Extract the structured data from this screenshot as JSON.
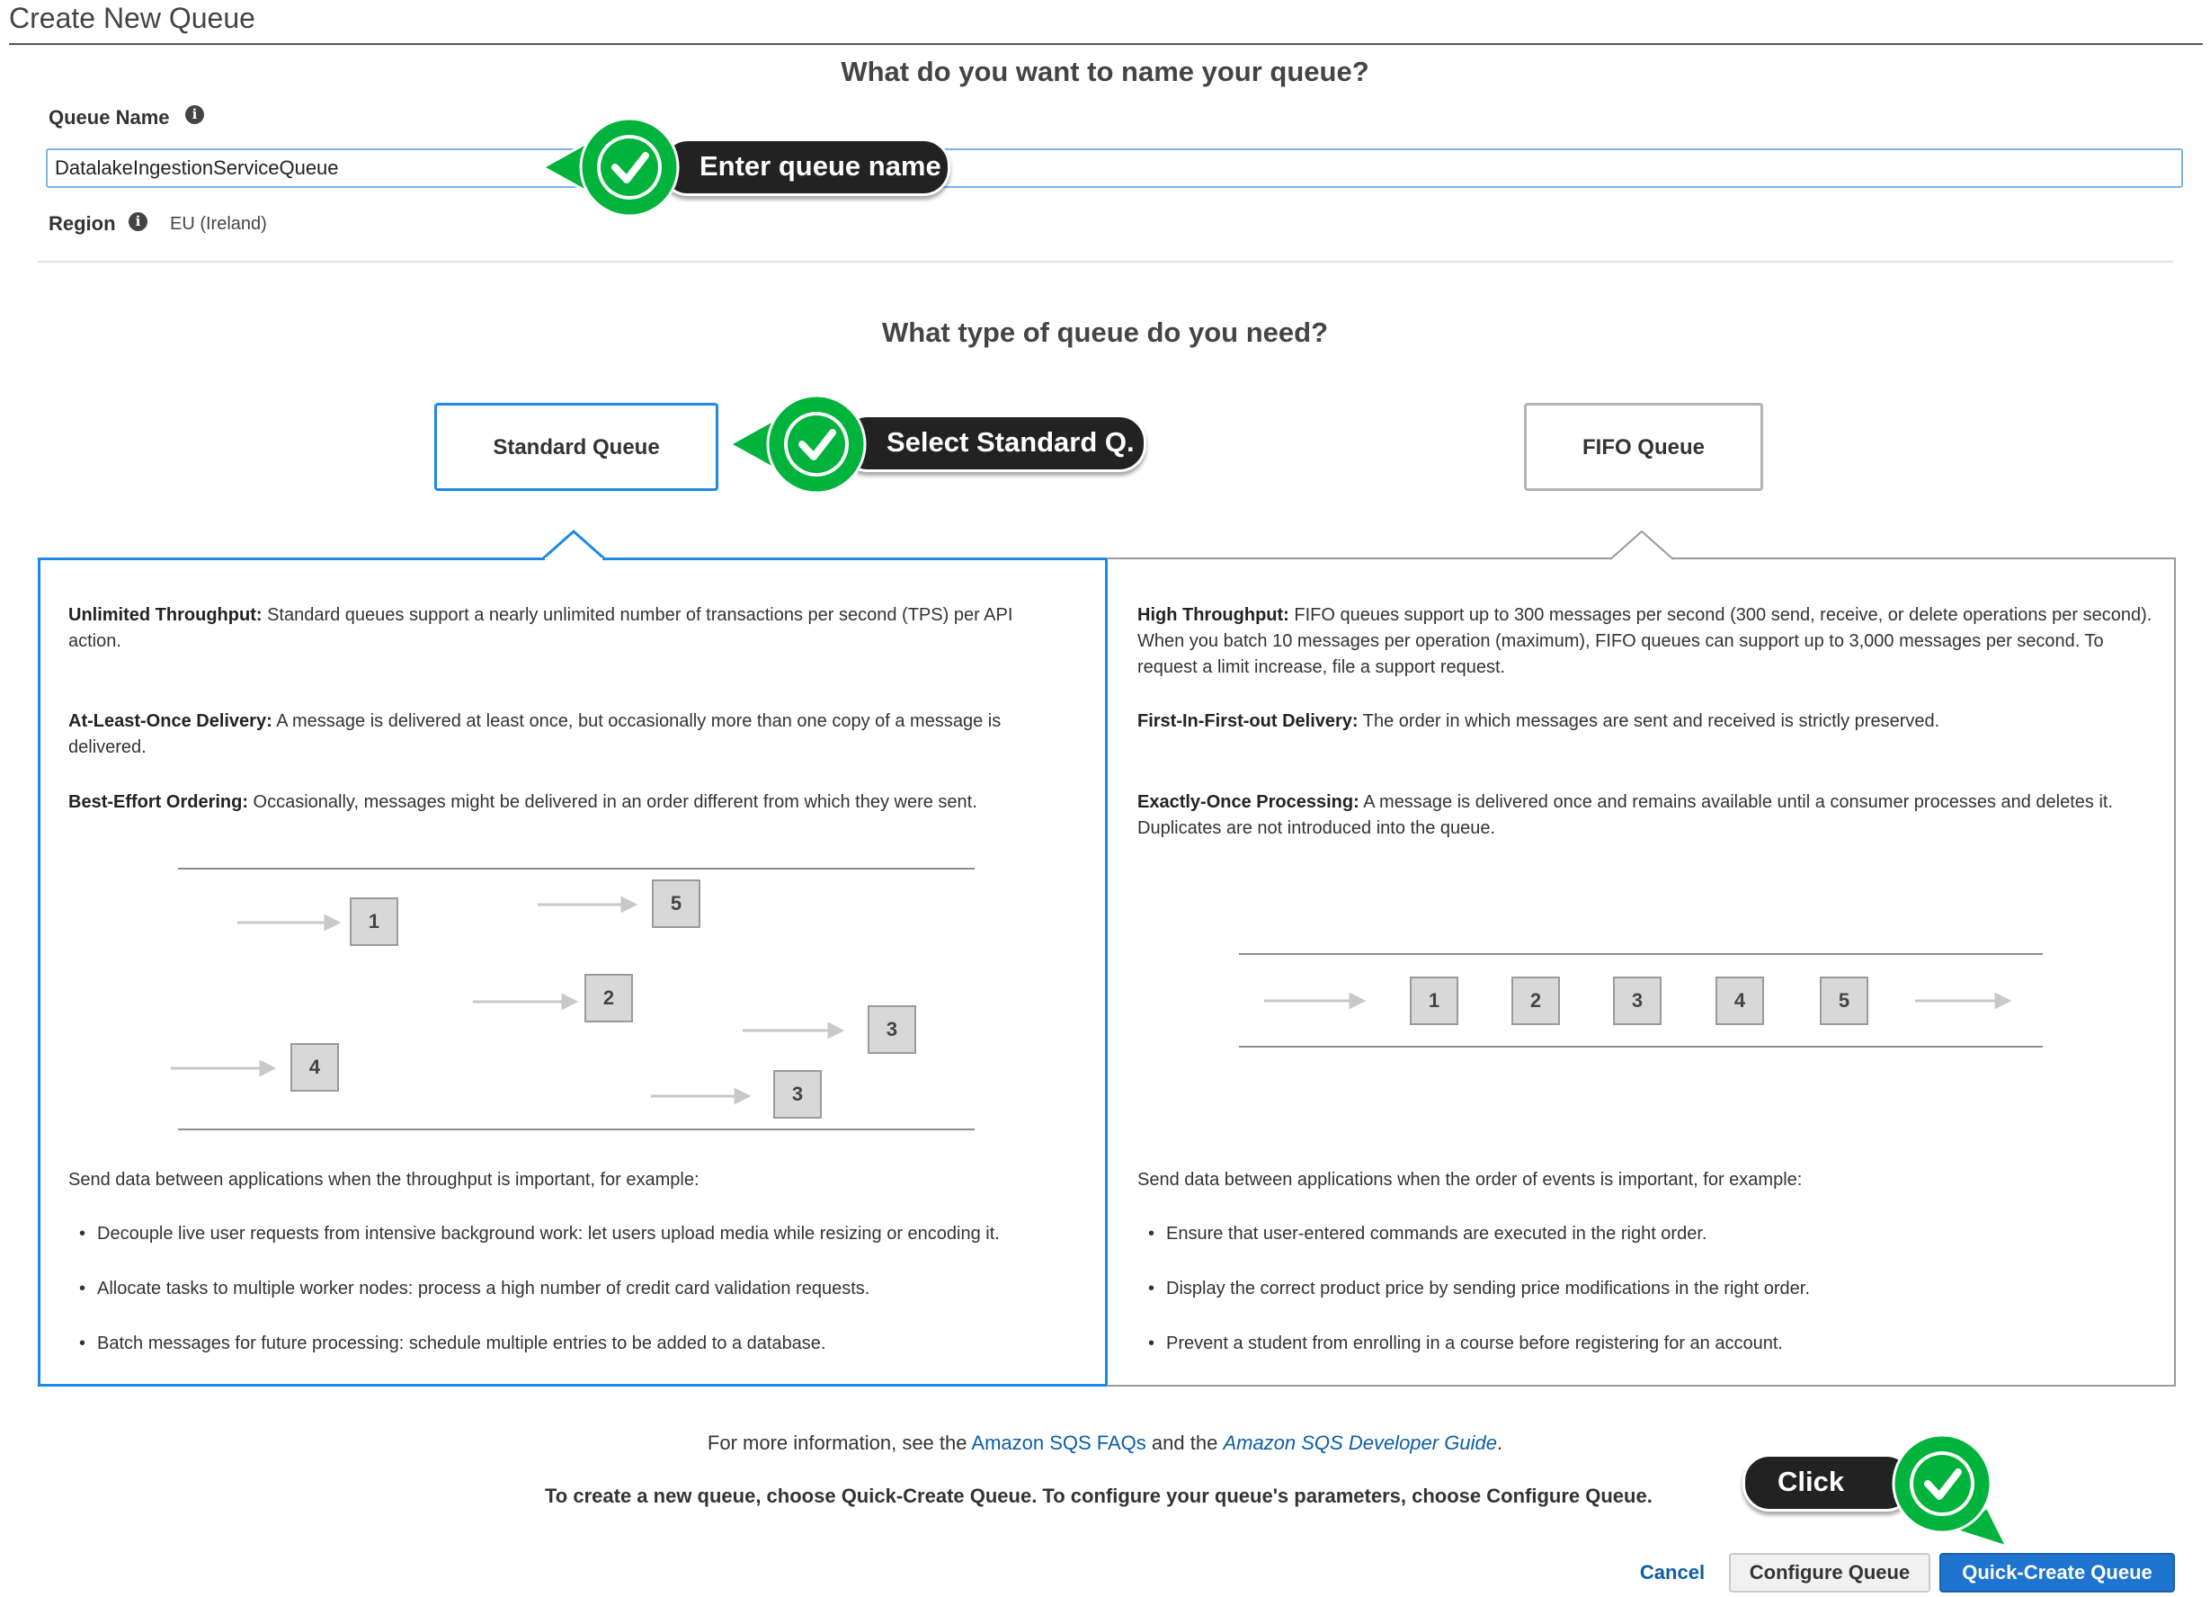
{
  "window": {
    "title": "Create New Queue"
  },
  "name_section": {
    "heading": "What do you want to name your queue?",
    "queue_name_label": "Queue Name",
    "queue_name_value": "DatalakeIngestionServiceQueue",
    "region_label": "Region",
    "region_value": "EU (Ireland)",
    "info_glyph": "i"
  },
  "type_section": {
    "heading": "What type of queue do you need?",
    "standard_label": "Standard Queue",
    "fifo_label": "FIFO Queue"
  },
  "standard_panel": {
    "features": [
      {
        "title": "Unlimited Throughput:",
        "text": " Standard queues support a nearly unlimited number of transactions per second (TPS) per API action."
      },
      {
        "title": "At-Least-Once Delivery:",
        "text": " A message is delivered at least once, but occasionally more than one copy of a message is delivered."
      },
      {
        "title": "Best-Effort Ordering:",
        "text": " Occasionally, messages might be delivered in an order different from which they were sent."
      }
    ],
    "diagram_numbers": [
      "1",
      "5",
      "2",
      "3",
      "4",
      "3"
    ],
    "use_case_intro": "Send data between applications when the throughput is important, for example:",
    "bullets": [
      "Decouple live user requests from intensive background work: let users upload media while resizing or encoding it.",
      "Allocate tasks to multiple worker nodes: process a high number of credit card validation requests.",
      "Batch messages for future processing: schedule multiple entries to be added to a database."
    ]
  },
  "fifo_panel": {
    "features": [
      {
        "title": "High Throughput:",
        "text": " FIFO queues support up to 300 messages per second (300 send, receive, or delete operations per second). When you batch 10 messages per operation (maximum), FIFO queues can support up to 3,000 messages per second. To request a limit increase, file a support request."
      },
      {
        "title": "First-In-First-out Delivery:",
        "text": " The order in which messages are sent and received is strictly preserved."
      },
      {
        "title": "Exactly-Once Processing:",
        "text": " A message is delivered once and remains available until a consumer processes and deletes it. Duplicates are not introduced into the queue."
      }
    ],
    "diagram_numbers": [
      "1",
      "2",
      "3",
      "4",
      "5"
    ],
    "use_case_intro": "Send data between applications when the order of events is important, for example:",
    "bullets": [
      "Ensure that user-entered commands are executed in the right order.",
      "Display the correct product price by sending price modifications in the right order.",
      "Prevent a student from enrolling in a course before registering for an account."
    ]
  },
  "footer": {
    "info_prefix": "For more information, see the ",
    "faq_link": "Amazon SQS FAQs",
    "info_mid": " and the ",
    "guide_link": "Amazon SQS Developer Guide",
    "info_suffix": ".",
    "instruction": "To create a new queue, choose Quick-Create Queue. To configure your queue's parameters, choose Configure Queue.",
    "cancel_label": "Cancel",
    "configure_label": "Configure Queue",
    "quick_create_label": "Quick-Create Queue"
  },
  "annotations": {
    "enter_name": "Enter queue name",
    "select_standard": "Select Standard Q.",
    "click": "Click"
  },
  "colors": {
    "selected_border": "#1e88e5",
    "primary_button": "#1f74d0",
    "link": "#0b5ea8",
    "annotation_green": "#00b33c",
    "annotation_dark": "#222222"
  }
}
